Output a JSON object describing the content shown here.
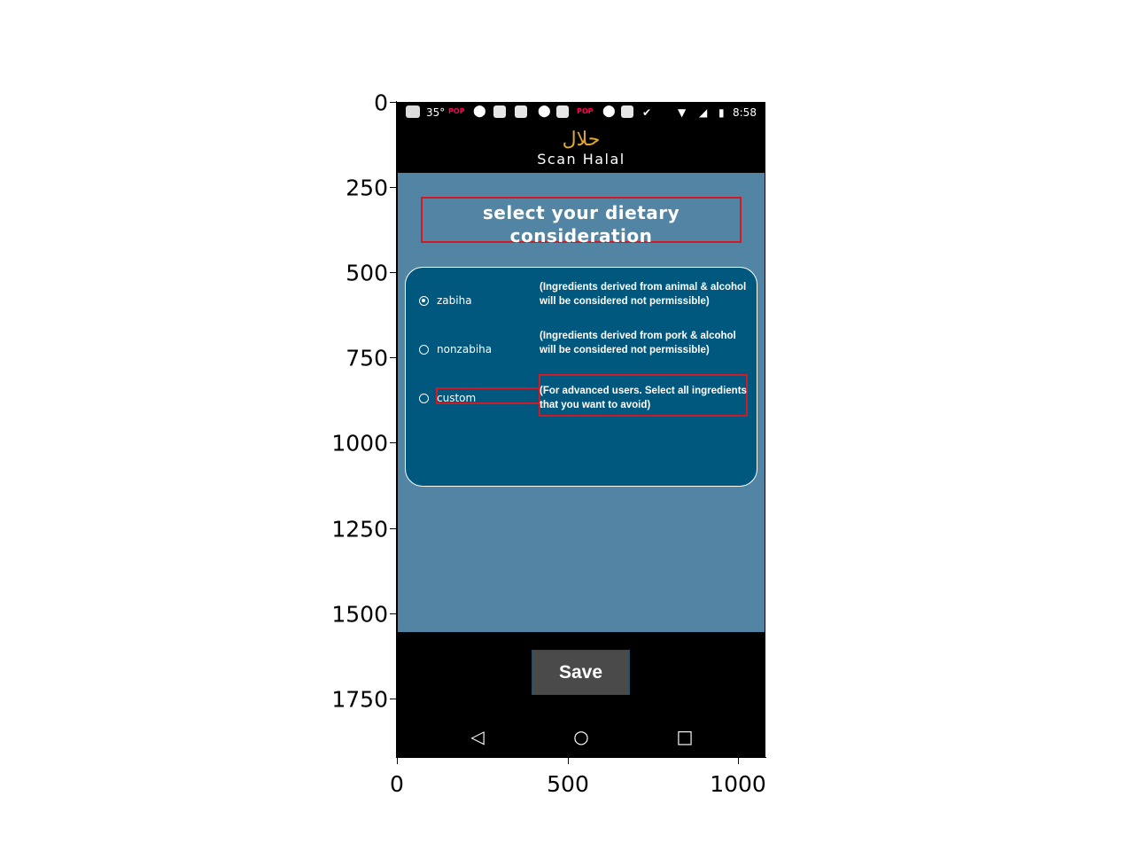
{
  "axes": {
    "y_ticks": [
      "0",
      "250",
      "500",
      "750",
      "1000",
      "1250",
      "1500",
      "1750"
    ],
    "x_ticks": [
      "0",
      "500",
      "1000"
    ]
  },
  "statusbar": {
    "temperature": "35°",
    "time": "8:58",
    "pop_badge": "POP"
  },
  "header": {
    "logo_arabic": "حلال",
    "logo_text": "Scan Halal"
  },
  "title": "select your dietary consideration",
  "options": [
    {
      "label": "zabiha",
      "description": "(Ingredients derived from animal & alcohol will be considered not permissible)",
      "selected": true
    },
    {
      "label": "nonzabiha",
      "description": "(Ingredients derived from pork & alcohol will be considered not permissible)",
      "selected": false
    },
    {
      "label": "custom",
      "description": "(For advanced users. Select all ingredients that you want to avoid)",
      "selected": false
    }
  ],
  "save_label": "Save",
  "nav": {
    "back_icon": "triangle-back-icon",
    "home_icon": "circle-home-icon",
    "recents_icon": "square-recents-icon"
  },
  "colors": {
    "content_bg": "#5185a3",
    "card_bg": "#00587e",
    "highlight": "#d01a25",
    "logo_gold": "#e2a72d"
  }
}
